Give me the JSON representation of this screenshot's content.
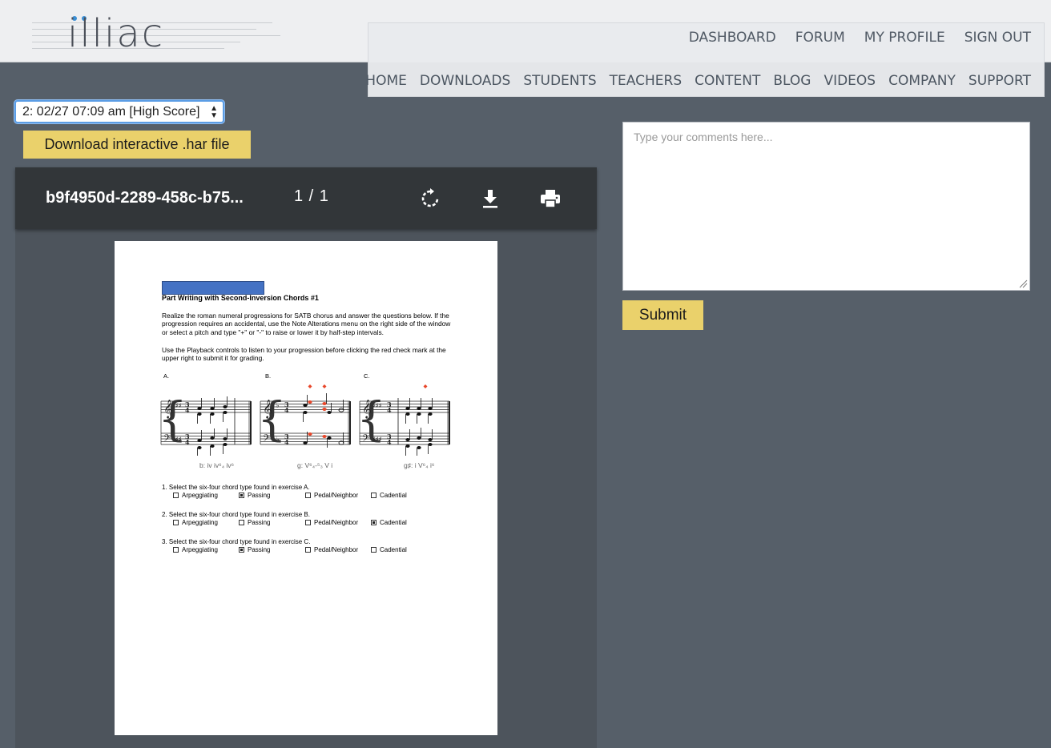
{
  "brand": {
    "logo_text": "illiac",
    "accent_color": "#3a8fd6"
  },
  "nav": {
    "top": [
      "DASHBOARD",
      "FORUM",
      "MY PROFILE",
      "SIGN OUT"
    ],
    "main": [
      "HOME",
      "DOWNLOADS",
      "STUDENTS",
      "TEACHERS",
      "CONTENT",
      "BLOG",
      "VIDEOS",
      "COMPANY",
      "SUPPORT"
    ]
  },
  "attempt_select": {
    "selected": "2: 02/27 07:09 am [High Score]"
  },
  "har_button": {
    "label": "Download interactive .har file"
  },
  "pdf": {
    "title": "b9f4950d-2289-458c-b75...",
    "page_indicator": "1  /  1",
    "icons": [
      "rotate-icon",
      "download-icon",
      "print-icon"
    ]
  },
  "document": {
    "title": "Part Writing with Second-Inversion Chords #1",
    "para1": "Realize the roman numeral progressions for SATB chorus and answer the questions below. If the progression requires an accidental, use the Note Alterations menu on the right side of the window or select a pitch and type \"+\" or \"-\" to raise or lower it by half-step intervals.",
    "para2": "Use the Playback controls to listen to your progression before clicking the red check mark at the upper right to submit it for grading.",
    "exercises": [
      {
        "label": "A.",
        "roman": "b: iv   iv⁶₄  iv⁶"
      },
      {
        "label": "B.",
        "roman": "g: V⁶₄-⁵₃  V   i"
      },
      {
        "label": "C.",
        "roman": "g♯: i   V⁶₄  i⁶"
      }
    ],
    "questions": [
      {
        "text": "1. Select the six-four chord type found in exercise A.",
        "options": [
          "Arpeggiating",
          "Passing",
          "Pedal/Neighbor",
          "Cadential"
        ],
        "checked": "Passing"
      },
      {
        "text": "2. Select the six-four chord type found in exercise B.",
        "options": [
          "Arpeggiating",
          "Passing",
          "Pedal/Neighbor",
          "Cadential"
        ],
        "checked": "Cadential"
      },
      {
        "text": "3. Select the six-four chord type found in exercise C.",
        "options": [
          "Arpeggiating",
          "Passing",
          "Pedal/Neighbor",
          "Cadential"
        ],
        "checked": "Passing"
      }
    ]
  },
  "comments": {
    "placeholder": "Type your comments here..."
  },
  "submit": {
    "label": "Submit"
  },
  "colors": {
    "background": "#565f69",
    "button_yellow": "#ead16b",
    "toolbar": "#323639",
    "highlight_red": "#e8472a"
  }
}
